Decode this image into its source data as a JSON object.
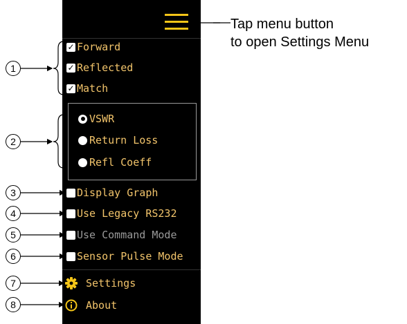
{
  "menu": {
    "checkboxes": [
      {
        "label": "Forward",
        "checked": true
      },
      {
        "label": "Reflected",
        "checked": true
      },
      {
        "label": "Match",
        "checked": true
      }
    ],
    "radios": [
      {
        "label": "VSWR",
        "selected": true
      },
      {
        "label": "Return Loss",
        "selected": false
      },
      {
        "label": "Refl Coeff",
        "selected": false
      }
    ],
    "options": [
      {
        "label": "Display Graph",
        "checked": false,
        "enabled": true
      },
      {
        "label": "Use Legacy RS232",
        "checked": false,
        "enabled": true
      },
      {
        "label": "Use Command Mode",
        "checked": false,
        "enabled": false
      },
      {
        "label": "Sensor Pulse Mode",
        "checked": false,
        "enabled": true
      }
    ],
    "actions": [
      {
        "label": "Settings",
        "icon": "gear-icon"
      },
      {
        "label": "About",
        "icon": "info-icon"
      }
    ]
  },
  "callouts": [
    "1",
    "2",
    "3",
    "4",
    "5",
    "6",
    "7",
    "8"
  ],
  "note": {
    "line1": "Tap menu button",
    "line2": "to open Settings Menu"
  },
  "colors": {
    "menu_background": "#000000",
    "menu_text": "#f2c46b",
    "hamburger": "#f5c518",
    "disabled_text": "#9a9a9a"
  }
}
